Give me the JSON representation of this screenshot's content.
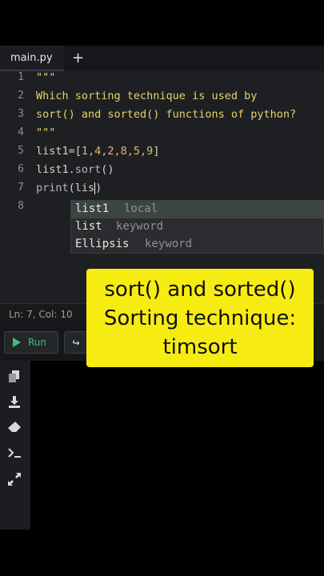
{
  "tab": {
    "filename": "main.py",
    "add": "+"
  },
  "editor": {
    "line_numbers": [
      "1",
      "2",
      "3",
      "4",
      "5",
      "6",
      "7",
      "8"
    ],
    "lines": {
      "l1": "\"\"\"",
      "l2": "Which sorting technique is used by",
      "l3": "sort() and sorted() functions of python?",
      "l4": "\"\"\"",
      "l5_name": "list1=[",
      "l5_values": "1,4,2,8,5,9",
      "l5_end": "]",
      "l6_obj": "list1.",
      "l6_method": "sort",
      "l6_end": "()",
      "l7_fn": "print",
      "l7_open": "(",
      "l7_arg": "lis",
      "l7_close": ")"
    }
  },
  "autocomplete": [
    {
      "name": "list1",
      "kind": "local"
    },
    {
      "name": "list",
      "kind": "keyword"
    },
    {
      "name": "Ellipsis",
      "kind": "keyword"
    }
  ],
  "status": {
    "position": "Ln: 7,  Col: 10"
  },
  "toolbar": {
    "run_label": "Run",
    "share_icon": "↪"
  },
  "sidebar_icons": [
    "copy-icon",
    "download-icon",
    "eraser-icon",
    "terminal-icon",
    "expand-icon"
  ],
  "overlay": {
    "line1": "sort() and sorted()",
    "line2": "Sorting technique:",
    "line3": "timsort"
  },
  "colors": {
    "string": "#e6d36a",
    "number": "#e6b673",
    "run": "#3ec07a",
    "overlay_bg": "#f7ec11"
  }
}
